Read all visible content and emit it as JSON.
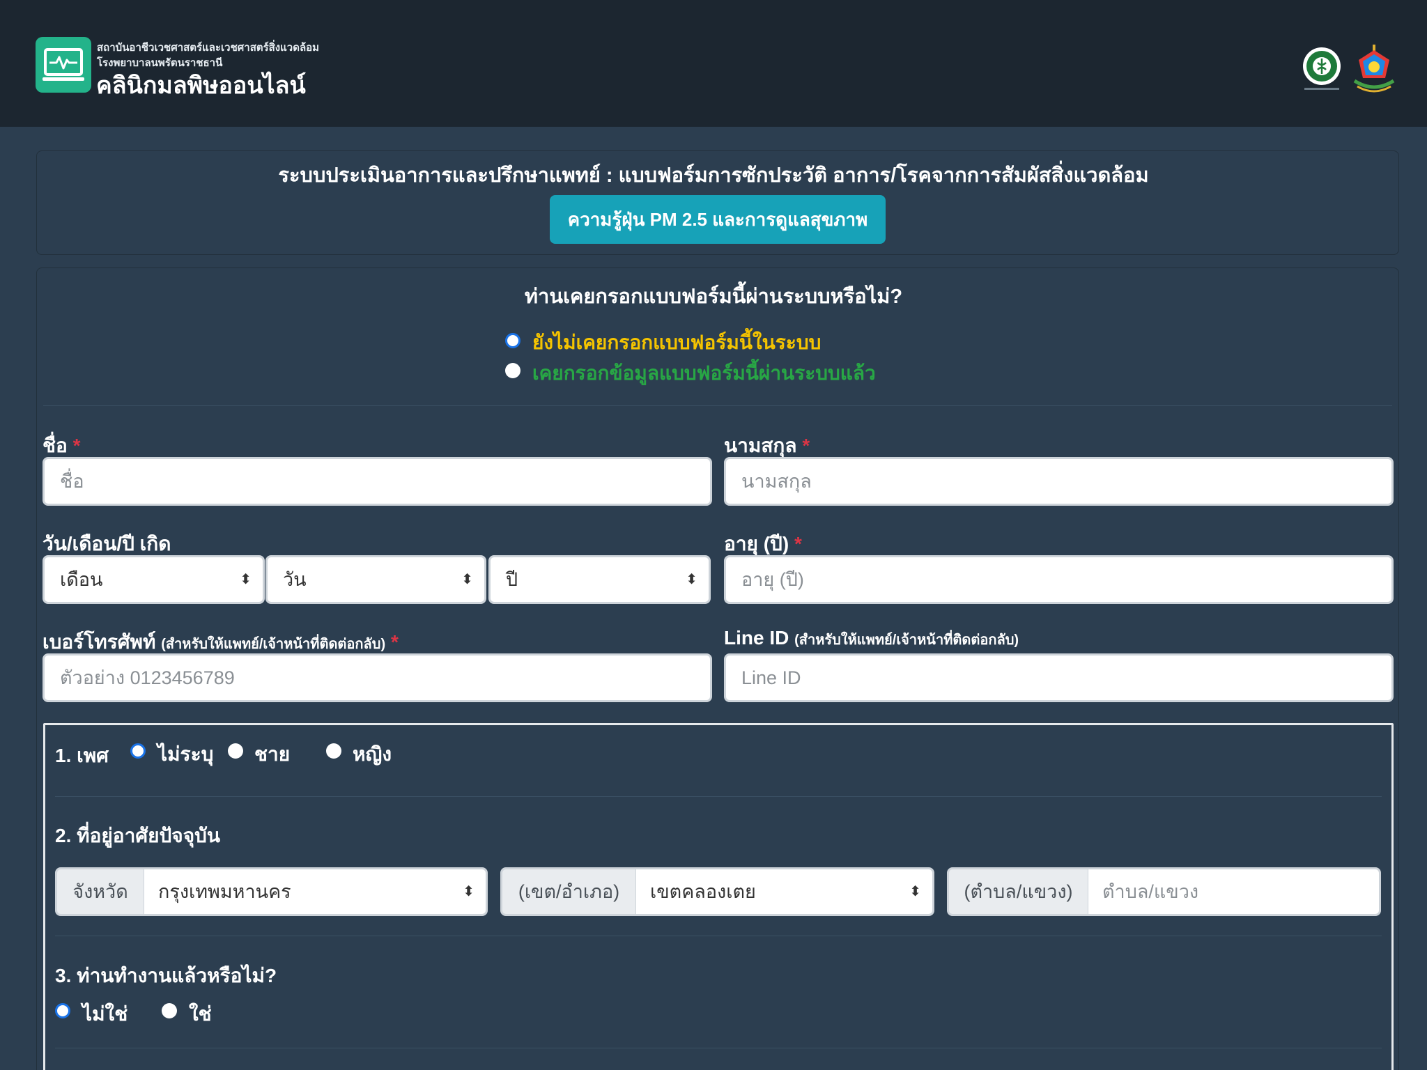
{
  "header": {
    "institute_line": "สถาบันอาชีวเวชศาสตร์และเวชศาสตร์สิ่งแวดล้อม",
    "hospital_line": "โรงพยาบาลนพรัตนราชธานี",
    "title": "คลินิกมลพิษออนไลน์",
    "logo_icon": "heartbeat-monitor-icon",
    "emblem_icons": [
      "ministry-of-public-health-emblem",
      "hospital-emblem"
    ]
  },
  "intro": {
    "title": "ระบบประเมินอาการและปรึกษาแพทย์ : แบบฟอร์มการซักประวัติ อาการ/โรคจากการสัมผัสสิ่งแวดล้อม",
    "info_button": "ความรู้ฝุ่น PM 2.5 และการดูแลสุขภาพ"
  },
  "prior_form": {
    "question": "ท่านเคยกรอกแบบฟอร์มนี้ผ่านระบบหรือไม่?",
    "options": [
      {
        "label": "ยังไม่เคยกรอกแบบฟอร์มนี้ในระบบ",
        "selected": true
      },
      {
        "label": "เคยกรอกข้อมูลแบบฟอร์มนี้ผ่านระบบแล้ว",
        "selected": false
      }
    ]
  },
  "fields": {
    "first_name": {
      "label": "ชื่อ",
      "required": "*",
      "placeholder": "ชื่อ",
      "value": ""
    },
    "last_name": {
      "label": "นามสกุล",
      "required": "*",
      "placeholder": "นามสกุล",
      "value": ""
    },
    "birthdate": {
      "label": "วัน/เดือน/ปี เกิด",
      "month": "เดือน",
      "day": "วัน",
      "year": "ปี"
    },
    "age": {
      "label": "อายุ (ปี)",
      "required": "*",
      "placeholder": "อายุ (ปี)",
      "value": ""
    },
    "phone": {
      "label": "เบอร์โทรศัพท์",
      "note": "(สำหรับให้แพทย์/เจ้าหน้าที่ติดต่อกลับ)",
      "required": "*",
      "placeholder": "ตัวอย่าง 0123456789",
      "value": ""
    },
    "line_id": {
      "label": "Line ID",
      "note": "(สำหรับให้แพทย์/เจ้าหน้าที่ติดต่อกลับ)",
      "placeholder": "Line ID",
      "value": ""
    }
  },
  "q1": {
    "label": "1. เพศ",
    "options": [
      {
        "label": "ไม่ระบุ",
        "selected": true
      },
      {
        "label": "ชาย",
        "selected": false
      },
      {
        "label": "หญิง",
        "selected": false
      }
    ]
  },
  "q2": {
    "label": "2. ที่อยู่อาศัยปัจจุบัน",
    "province_label": "จังหวัด",
    "province_value": "กรุงเทพมหานคร",
    "district_label": "(เขต/อำเภอ)",
    "district_value": "เขตคลองเตย",
    "subdistrict_label": "(ตำบล/แขวง)",
    "subdistrict_placeholder": "ตำบล/แขวง"
  },
  "q3": {
    "label": "3. ท่านทำงานแล้วหรือไม่?",
    "options": [
      {
        "label": "ไม่ใช่",
        "selected": true
      },
      {
        "label": "ใช่",
        "selected": false
      }
    ]
  },
  "colors": {
    "page_bg": "#2c3e50",
    "header_bg": "#1c2630",
    "accent_teal": "#17a2b8",
    "logo_green": "#23b38a",
    "option_yellow": "#f5c400",
    "option_green": "#28a745",
    "required_red": "#dc3545",
    "radio_blue": "#1a73e8"
  }
}
